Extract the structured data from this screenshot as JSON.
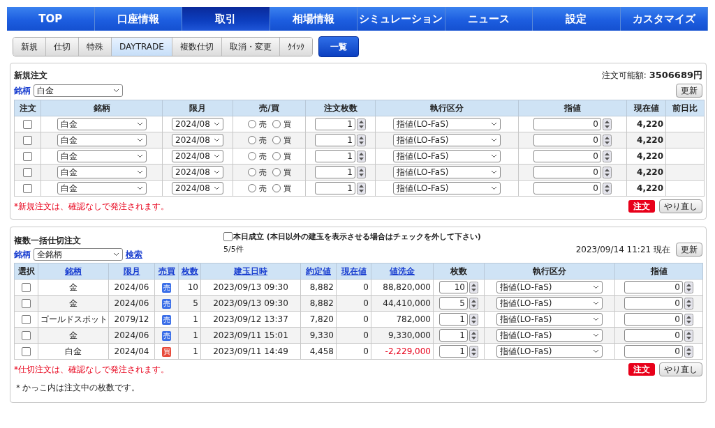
{
  "nav": [
    {
      "label": "TOP",
      "selected": false
    },
    {
      "label": "口座情報",
      "selected": false
    },
    {
      "label": "取引",
      "selected": true
    },
    {
      "label": "相場情報",
      "selected": false
    },
    {
      "label": "シミュレーション",
      "selected": false
    },
    {
      "label": "ニュース",
      "selected": false
    },
    {
      "label": "設定",
      "selected": false
    },
    {
      "label": "カスタマイズ",
      "selected": false
    }
  ],
  "subnav": [
    {
      "label": "新規",
      "selected": false,
      "kind": "tab"
    },
    {
      "label": "仕切",
      "selected": false,
      "kind": "tab"
    },
    {
      "label": "特殊",
      "selected": false,
      "kind": "tab"
    },
    {
      "label": "DAYTRADE",
      "selected": true,
      "kind": "tab"
    },
    {
      "label": "複数仕切",
      "selected": false,
      "kind": "tab"
    },
    {
      "label": "取消・変更",
      "selected": false,
      "kind": "tab"
    },
    {
      "label": "ｸｲｯｸ",
      "selected": false,
      "kind": "tab"
    },
    {
      "label": "一覧",
      "selected": false,
      "kind": "primary"
    }
  ],
  "new_order": {
    "title": "新規注文",
    "available_label": "注文可能額:",
    "available_value": "3506689円",
    "symbol_label": "銘柄",
    "symbol_value": "白金",
    "refresh": "更新",
    "columns": [
      "注文",
      "銘柄",
      "限月",
      "売/買",
      "注文枚数",
      "執行区分",
      "指値",
      "現在値",
      "前日比"
    ],
    "rows": [
      {
        "checked": false,
        "symbol": "白金",
        "month": "2024/08",
        "sell_label": "売",
        "sell_selected": false,
        "buy_label": "買",
        "buy_selected": false,
        "quantity": "1",
        "execution": "指値(LO-FaS)",
        "price": "0",
        "current": "4,220"
      },
      {
        "checked": false,
        "symbol": "白金",
        "month": "2024/08",
        "sell_label": "売",
        "sell_selected": false,
        "buy_label": "買",
        "buy_selected": false,
        "quantity": "1",
        "execution": "指値(LO-FaS)",
        "price": "0",
        "current": "4,220"
      },
      {
        "checked": false,
        "symbol": "白金",
        "month": "2024/08",
        "sell_label": "売",
        "sell_selected": false,
        "buy_label": "買",
        "buy_selected": false,
        "quantity": "1",
        "execution": "指値(LO-FaS)",
        "price": "0",
        "current": "4,220"
      },
      {
        "checked": false,
        "symbol": "白金",
        "month": "2024/08",
        "sell_label": "売",
        "sell_selected": false,
        "buy_label": "買",
        "buy_selected": false,
        "quantity": "1",
        "execution": "指値(LO-FaS)",
        "price": "0",
        "current": "4,220"
      },
      {
        "checked": false,
        "symbol": "白金",
        "month": "2024/08",
        "sell_label": "売",
        "sell_selected": false,
        "buy_label": "買",
        "buy_selected": false,
        "quantity": "1",
        "execution": "指値(LO-FaS)",
        "price": "0",
        "current": "4,220"
      }
    ],
    "notice": "*新規注文は、確認なしで発注されます。",
    "order_button": "注文",
    "reset_button": "やり直し"
  },
  "bulk_close": {
    "title": "複数一括仕切注文",
    "today_label": "本日成立 (本日以外の建玉を表示させる場合はチェックを外して下さい)",
    "today_checked": false,
    "count": "5/5件",
    "timestamp": "2023/09/14 11:21 現在",
    "refresh": "更新",
    "symbol_label": "銘柄",
    "symbol_value": "全銘柄",
    "search_link": "検索",
    "columns": [
      {
        "label": "選択",
        "link": false
      },
      {
        "label": "銘柄",
        "link": true
      },
      {
        "label": "限月",
        "link": true
      },
      {
        "label": "売買",
        "link": true
      },
      {
        "label": "枚数",
        "link": true
      },
      {
        "label": "建玉日時",
        "link": true
      },
      {
        "label": "約定値",
        "link": true
      },
      {
        "label": "現在値",
        "link": true
      },
      {
        "label": "値洗金",
        "link": true
      },
      {
        "label": "枚数",
        "link": false
      },
      {
        "label": "執行区分",
        "link": false
      },
      {
        "label": "指値",
        "link": false
      }
    ],
    "rows": [
      {
        "checked": false,
        "symbol": "金",
        "month": "2024/06",
        "side": {
          "label": "売",
          "kind": "sell"
        },
        "lots": "10",
        "opened": "2023/09/13 09:30",
        "fill_price": "8,882",
        "current": "0",
        "valuation": "88,820,000",
        "loss": false,
        "quantity": "10",
        "execution": "指値(LO-FaS)",
        "price": "0"
      },
      {
        "checked": false,
        "symbol": "金",
        "month": "2024/06",
        "side": {
          "label": "売",
          "kind": "sell"
        },
        "lots": "5",
        "opened": "2023/09/13 09:30",
        "fill_price": "8,882",
        "current": "0",
        "valuation": "44,410,000",
        "loss": false,
        "quantity": "5",
        "execution": "指値(LO-FaS)",
        "price": "0"
      },
      {
        "checked": false,
        "symbol": "ゴールドスポット",
        "month": "2079/12",
        "side": {
          "label": "売",
          "kind": "sell"
        },
        "lots": "1",
        "opened": "2023/09/12 13:37",
        "fill_price": "7,820",
        "current": "0",
        "valuation": "782,000",
        "loss": false,
        "quantity": "1",
        "execution": "指値(LO-FaS)",
        "price": "0"
      },
      {
        "checked": false,
        "symbol": "金",
        "month": "2024/06",
        "side": {
          "label": "売",
          "kind": "sell"
        },
        "lots": "1",
        "opened": "2023/09/11 15:01",
        "fill_price": "9,330",
        "current": "0",
        "valuation": "9,330,000",
        "loss": false,
        "quantity": "1",
        "execution": "指値(LO-FaS)",
        "price": "0"
      },
      {
        "checked": false,
        "symbol": "白金",
        "month": "2024/04",
        "side": {
          "label": "買",
          "kind": "buy"
        },
        "lots": "1",
        "opened": "2023/09/11 14:49",
        "fill_price": "4,458",
        "current": "0",
        "valuation": "-2,229,000",
        "loss": true,
        "quantity": "1",
        "execution": "指値(LO-FaS)",
        "price": "0"
      }
    ],
    "notice": "*仕切注文は、確認なしで発注されます。",
    "order_button": "注文",
    "reset_button": "やり直し",
    "footnote": "＊かっこ内は注文中の枚数です。"
  }
}
